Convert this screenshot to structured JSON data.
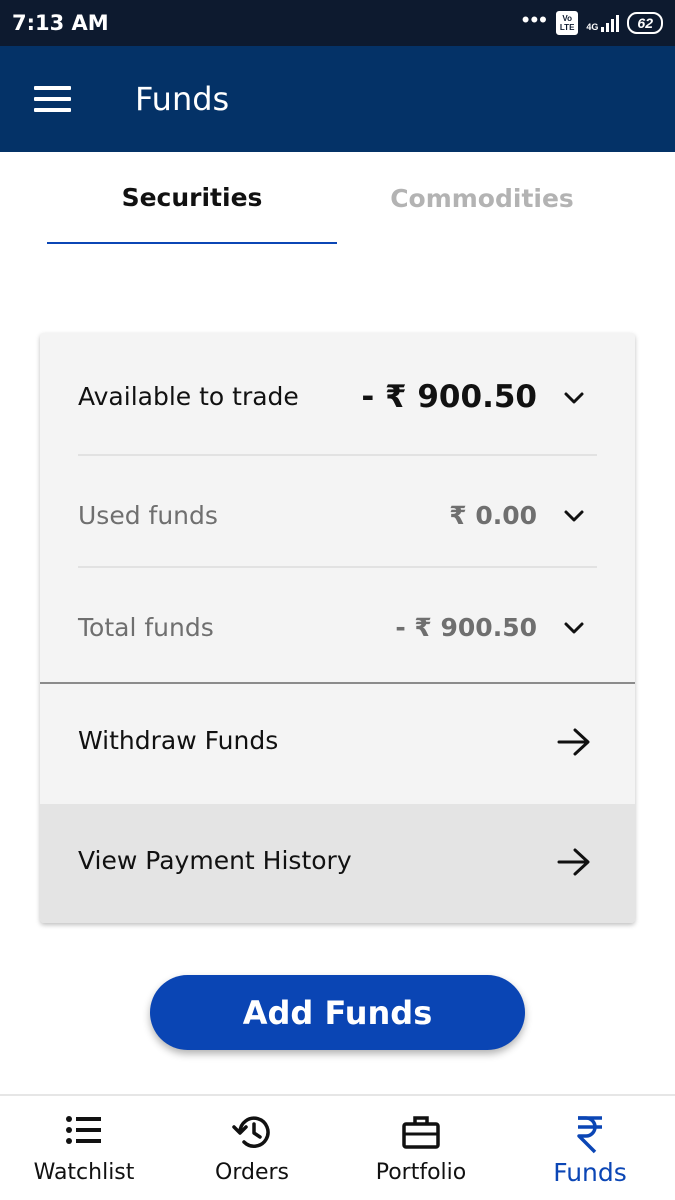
{
  "status_bar": {
    "time": "7:13 AM",
    "volte": "Vo LTE",
    "network": "4G",
    "battery": "62"
  },
  "app_bar": {
    "title": "Funds",
    "menu_icon": "hamburger-menu-icon"
  },
  "tabs": [
    {
      "label": "Securities",
      "active": true
    },
    {
      "label": "Commodities",
      "active": false
    }
  ],
  "funds": {
    "available": {
      "label": "Available to trade",
      "value": "- ₹ 900.50"
    },
    "used": {
      "label": "Used funds",
      "value": "₹ 0.00"
    },
    "total": {
      "label": "Total funds",
      "value": "- ₹ 900.50"
    }
  },
  "links": {
    "withdraw": "Withdraw Funds",
    "payment_history": "View Payment History"
  },
  "add_funds_label": "Add Funds",
  "bottom_nav": {
    "items": [
      {
        "label": "Watchlist",
        "icon": "list-icon",
        "active": false
      },
      {
        "label": "Orders",
        "icon": "history-icon",
        "active": false
      },
      {
        "label": "Portfolio",
        "icon": "briefcase-icon",
        "active": false
      },
      {
        "label": "Funds",
        "icon": "rupee-icon",
        "active": true
      }
    ]
  },
  "colors": {
    "app_bar": "#043267",
    "status_bar": "#0d1a2f",
    "accent": "#0a45b4",
    "card_bg": "#f4f4f4",
    "highlight_row": "#e4e4e4"
  }
}
